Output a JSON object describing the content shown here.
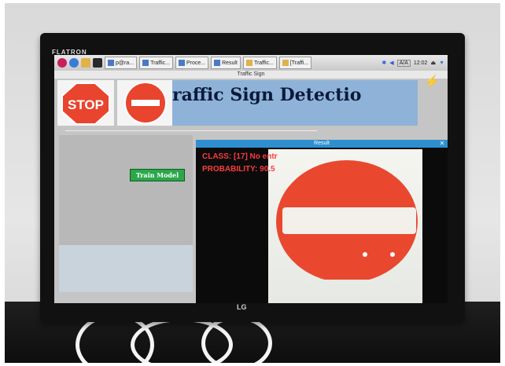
{
  "monitor": {
    "brand_top": "FLATRON",
    "brand_bottom": "LG"
  },
  "taskbar": {
    "tasks": [
      "p@ra...",
      "Traffic...",
      "Proce...",
      "Result",
      "Traffic...",
      "[Traffi..."
    ],
    "clock": "12:02",
    "mode": "A/A"
  },
  "app": {
    "window_title": "Traffic Sign",
    "header_title": "raffic Sign Detectio",
    "train_button_label": "Train Model",
    "signs": [
      {
        "name": "stop-sign",
        "text": "STOP"
      },
      {
        "name": "no-entry-sign",
        "text": ""
      }
    ]
  },
  "result_window": {
    "title": "Result",
    "class_text": "CLASS:  [17] No entr",
    "probability_text": "PROBABILITY: 90.5"
  },
  "colors": {
    "header_band": "#8fb3d8",
    "button_green": "#2aa84a",
    "result_text_red": "#ff3b3b",
    "sign_red": "#e8442e"
  }
}
